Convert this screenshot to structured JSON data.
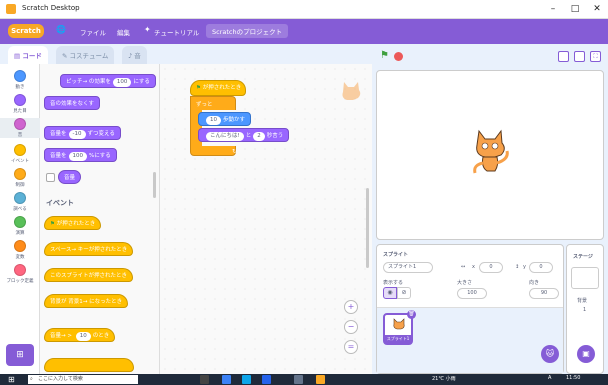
{
  "window": {
    "title": "Scratch Desktop",
    "min": "–",
    "max": "□",
    "close": "✕"
  },
  "menubar": {
    "logo": "Scratch",
    "items": [
      "ファイル",
      "編集",
      "チュートリアル"
    ],
    "project": "Scratchのプロジェクト"
  },
  "tabs": [
    "コード",
    "コスチューム",
    "音"
  ],
  "categories": [
    {
      "label": "動き",
      "color": "#4c97ff"
    },
    {
      "label": "見た目",
      "color": "#9966ff"
    },
    {
      "label": "音",
      "color": "#cf63cf"
    },
    {
      "label": "イベント",
      "color": "#ffbf00"
    },
    {
      "label": "制御",
      "color": "#ffab19"
    },
    {
      "label": "調べる",
      "color": "#5cb1d6"
    },
    {
      "label": "演算",
      "color": "#59c059"
    },
    {
      "label": "変数",
      "color": "#ff8c1a"
    },
    {
      "label": "ブロック定義",
      "color": "#ff6680"
    }
  ],
  "palette": {
    "b1a": "ピッチ→",
    "b1b": "の効果を",
    "b1v": "100",
    "b1c": "にする",
    "b2": "音の効果をなくす",
    "b3a": "音量を",
    "b3v": "-10",
    "b3b": "ずつ変える",
    "b4a": "音量を",
    "b4v": "100",
    "b4b": "%にする",
    "b5": "音量",
    "event_heading": "イベント",
    "e1": "が押されたとき",
    "e2a": "スペース→",
    "e2b": "キーが押されたとき",
    "e3": "このスプライトが押されたとき",
    "e4a": "背景が",
    "e4b": "背景1→",
    "e4c": "になったとき",
    "e5a": "音量→",
    "e5v": "10",
    "e5b": "のとき"
  },
  "script": {
    "hat": "が押されたとき",
    "forever": "ずっと",
    "move_v": "10",
    "move": "歩動かす",
    "say_v": "こんにちは!",
    "say_mid": "と",
    "say_n": "2",
    "say_end": "秒言う",
    "zoom_in": "+",
    "zoom_out": "−",
    "zoom_reset": "="
  },
  "sprite": {
    "label": "スプライト",
    "name": "スプライト1",
    "x_label": "x",
    "x": "0",
    "y_label": "y",
    "y": "0",
    "show_label": "表示する",
    "size_label": "大きさ",
    "size": "100",
    "dir_label": "向き",
    "dir": "90",
    "thumb_label": "スプライト1"
  },
  "stagepane": {
    "title": "ステージ",
    "bg_label": "背景",
    "bg_count": "1"
  },
  "taskbar": {
    "search": "ここに入力して検索",
    "weather": "21℃ 小雨",
    "time": "11:50",
    "ime": "A"
  }
}
